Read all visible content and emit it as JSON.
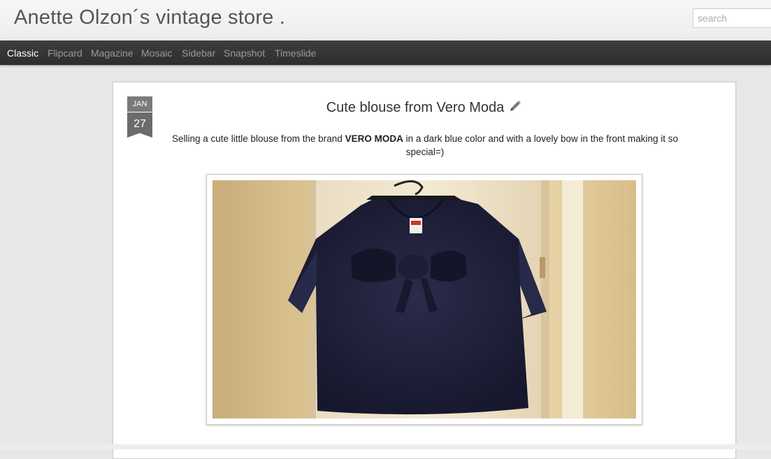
{
  "blog": {
    "title": "Anette Olzon´s vintage store ."
  },
  "search": {
    "placeholder": "search"
  },
  "nav": {
    "items": [
      {
        "label": "Classic",
        "active": true
      },
      {
        "label": "Flipcard"
      },
      {
        "label": "Magazine"
      },
      {
        "label": "Mosaic"
      },
      {
        "label": "Sidebar"
      },
      {
        "label": "Snapshot"
      },
      {
        "label": "Timeslide"
      }
    ]
  },
  "post": {
    "date_month": "JAN",
    "date_day": "27",
    "title": "Cute blouse from Vero Moda",
    "body_before": "Selling a cute little blouse from the brand ",
    "body_brand": "VERO MODA",
    "body_after": " in a dark blue color and with a lovely bow in the front making it so special=)",
    "image_icon": "photo-of-navy-blouse-with-bow",
    "label_tag": "VERO MODA"
  },
  "icons": {
    "edit": "pencil-icon"
  },
  "colors": {
    "nav_bg": "#333333",
    "nav_active": "#ffffff",
    "nav_text": "#9a9a9a",
    "blouse": "#1c1e36"
  }
}
